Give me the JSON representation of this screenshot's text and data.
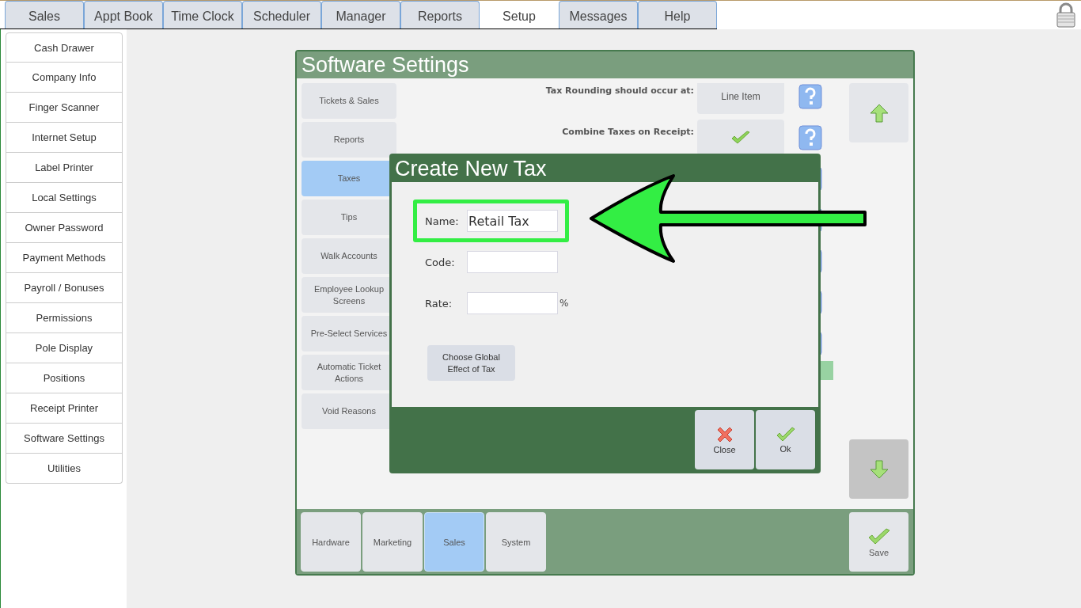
{
  "top_tabs": [
    {
      "label": "Sales",
      "selected": false
    },
    {
      "label": "Appt Book",
      "selected": false
    },
    {
      "label": "Time Clock",
      "selected": false
    },
    {
      "label": "Scheduler",
      "selected": false
    },
    {
      "label": "Manager",
      "selected": false
    },
    {
      "label": "Reports",
      "selected": false
    },
    {
      "label": "Setup",
      "selected": true
    },
    {
      "label": "Messages",
      "selected": false
    },
    {
      "label": "Help",
      "selected": false
    }
  ],
  "sidebar": {
    "items": [
      {
        "label": "Cash Drawer",
        "selected": false
      },
      {
        "label": "Company Info",
        "selected": false
      },
      {
        "label": "Finger Scanner",
        "selected": false
      },
      {
        "label": "Internet Setup",
        "selected": false
      },
      {
        "label": "Label Printer",
        "selected": false
      },
      {
        "label": "Local Settings",
        "selected": false
      },
      {
        "label": "Owner Password",
        "selected": false
      },
      {
        "label": "Payment Methods",
        "selected": false
      },
      {
        "label": "Payroll / Bonuses",
        "selected": false
      },
      {
        "label": "Permissions",
        "selected": false
      },
      {
        "label": "Pole Display",
        "selected": false
      },
      {
        "label": "Positions",
        "selected": false
      },
      {
        "label": "Receipt Printer",
        "selected": false
      },
      {
        "label": "Software Settings",
        "selected": false
      },
      {
        "label": "Utilities",
        "selected": false
      }
    ]
  },
  "settings_panel": {
    "title": "Software Settings",
    "categories": [
      {
        "label": "Tickets & Sales",
        "selected": false
      },
      {
        "label": "Reports",
        "selected": false
      },
      {
        "label": "Taxes",
        "selected": true
      },
      {
        "label": "Tips",
        "selected": false
      },
      {
        "label": "Walk Accounts",
        "selected": false
      },
      {
        "label": "Employee Lookup Screens",
        "selected": false
      },
      {
        "label": "Pre-Select Services",
        "selected": false
      },
      {
        "label": "Automatic Ticket Actions",
        "selected": false
      },
      {
        "label": "Void Reasons",
        "selected": false
      }
    ],
    "rows": [
      {
        "kind": "choice",
        "label": "Tax Rounding should occur at:",
        "value": "Line Item"
      },
      {
        "kind": "toggle",
        "label": "Combine Taxes on Receipt:",
        "checked": true
      },
      {
        "kind": "covered"
      },
      {
        "kind": "covered"
      },
      {
        "kind": "covered"
      },
      {
        "kind": "covered"
      },
      {
        "kind": "covered"
      },
      {
        "kind": "bar"
      }
    ],
    "bottom_tabs": [
      {
        "label": "Hardware",
        "selected": false
      },
      {
        "label": "Marketing",
        "selected": false
      },
      {
        "label": "Sales",
        "selected": true
      },
      {
        "label": "System",
        "selected": false
      }
    ],
    "save_button": "Save"
  },
  "dialog": {
    "title": "Create New Tax",
    "fields": [
      {
        "label": "Name:",
        "value": "Retail Tax",
        "highlighted": true
      },
      {
        "label": "Code:",
        "highlighted": false
      },
      {
        "label": "Rate:",
        "highlighted": false,
        "suffix": "%"
      }
    ],
    "global_effect_button": "Choose Global Effect of Tax",
    "buttons": [
      {
        "kind": "close",
        "label": "Close"
      },
      {
        "kind": "ok",
        "label": "Ok"
      }
    ]
  }
}
